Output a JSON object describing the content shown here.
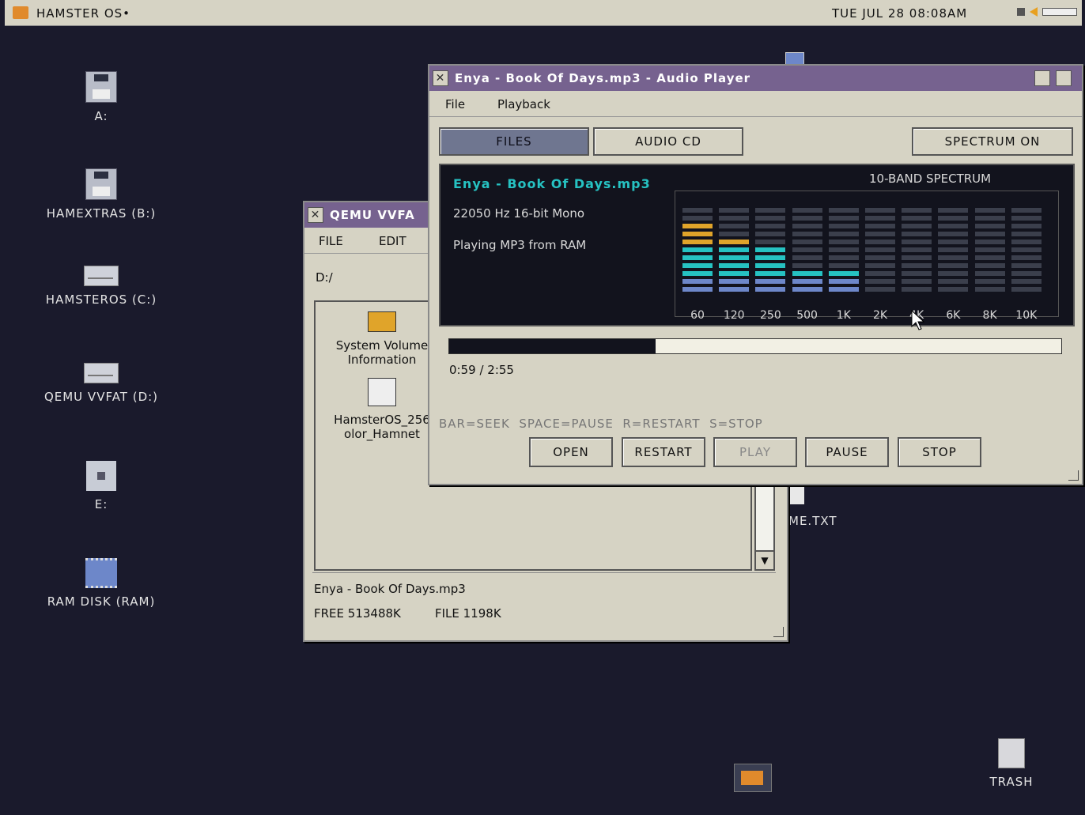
{
  "menubar": {
    "title": "HAMSTER OS•",
    "clock": "TUE JUL 28 08:08AM"
  },
  "desktop": {
    "drives": [
      {
        "label": "A:",
        "icon": "floppy-icon"
      },
      {
        "label": "HAMEXTRAS (B:)",
        "icon": "floppy-icon"
      },
      {
        "label": "HAMSTEROS (C:)",
        "icon": "hard-drive-icon"
      },
      {
        "label": "QEMU VVFAT (D:)",
        "icon": "hard-drive-icon"
      },
      {
        "label": "E:",
        "icon": "empty-drive-icon"
      },
      {
        "label": "RAM DISK (RAM)",
        "icon": "ram-disk-icon"
      }
    ],
    "readme_label": "ME.TXT",
    "trash_label": "TRASH"
  },
  "file_window": {
    "title": "QEMU VVFA",
    "menu": [
      "FILE",
      "EDIT"
    ],
    "path": "D:/",
    "items": [
      {
        "line1": "System Volume",
        "line2": "Information",
        "icon": "folder-icon"
      },
      {
        "line1": "HamsterOS_256",
        "line2": "olor_Hamnet",
        "icon": "image-file-icon"
      }
    ],
    "status_file": "Enya - Book Of Days.mp3",
    "free": "FREE 513488K",
    "file_size": "FILE 1198K"
  },
  "player": {
    "title": "Enya - Book Of Days.mp3 - Audio Player",
    "menu": [
      "File",
      "Playback"
    ],
    "tabs": {
      "files": "FILES",
      "audio_cd": "AUDIO CD",
      "spectrum": "SPECTRUM ON"
    },
    "track": "Enya - Book Of Days.mp3",
    "format": "22050 Hz 16-bit Mono",
    "source": "Playing MP3 from RAM",
    "spectrum_title": "10-BAND SPECTRUM",
    "bands": [
      "60",
      "120",
      "250",
      "500",
      "1K",
      "2K",
      "4K",
      "6K",
      "8K",
      "10K"
    ],
    "band_levels": [
      9,
      7,
      6,
      3,
      3,
      0,
      0,
      0,
      0,
      0
    ],
    "progress": 0.337,
    "time": "0:59 / 2:55",
    "hints": "BAR=SEEK  SPACE=PAUSE  R=RESTART  S=STOP",
    "buttons": {
      "open": "OPEN",
      "restart": "RESTART",
      "play": "PLAY",
      "pause": "PAUSE",
      "stop": "STOP"
    }
  },
  "colors": {
    "desktop": "#1a1a2c",
    "titlebar": "#76628f",
    "accent_cyan": "#26c2c2",
    "accent_orange": "#e0a42a",
    "accent_blue": "#6d87c9"
  }
}
